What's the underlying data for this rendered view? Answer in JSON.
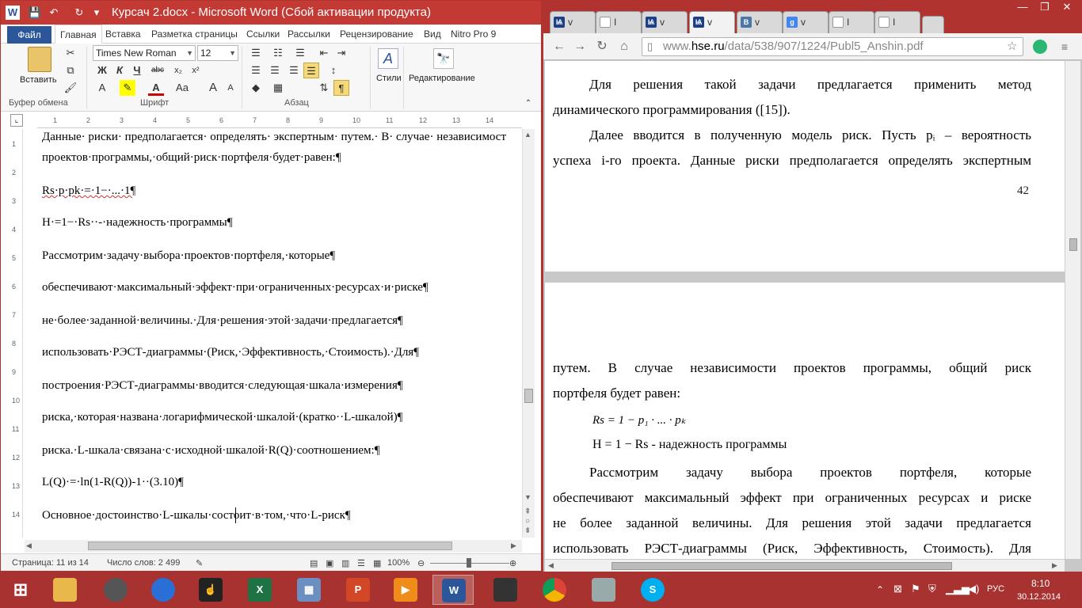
{
  "word": {
    "title": "Курсач 2.docx - Microsoft Word (Сбой активации продукта)",
    "qat": [
      "W",
      "💾",
      "↶",
      "↻",
      "▾"
    ],
    "window_controls": [
      "?",
      "⊡",
      "—",
      "▭",
      "✕"
    ],
    "tabs": [
      "Файл",
      "Главная",
      "Вставка",
      "Разметка страницы",
      "Ссылки",
      "Рассылки",
      "Рецензирование",
      "Вид",
      "Nitro Pro 9"
    ],
    "active_tab": "Главная",
    "ribbon": {
      "paste_label": "Вставить",
      "clipboard_label": "Буфер обмена",
      "font_label": "Шрифт",
      "paragraph_label": "Абзац",
      "styles_label": "Стили",
      "editing_label": "Редактирование",
      "font_name": "Times New Roman",
      "font_size": "12",
      "font_buttons": [
        "Ж",
        "К",
        "Ч",
        "abc",
        "x₂",
        "x²",
        "A",
        "Aa",
        "A",
        "A"
      ],
      "para_buttons": [
        "☰",
        "☰",
        "☰",
        "☰",
        "¶"
      ]
    },
    "ruler_numbers": [
      "1",
      "2",
      "3",
      "4",
      "5",
      "6",
      "7",
      "8",
      "9",
      "10",
      "11",
      "12",
      "13",
      "14"
    ],
    "doc_lines": [
      "Данные· риски· предполагается· определять· экспертным· путем.· В· случае· независимост",
      "проектов·программы,·общий·риск·портфеля·будет·равен:¶",
      "Rs·p·pk·=·1−·...·1¶",
      "H·=1−·Rs··-·надежность·программы¶",
      "Рассмотрим·задачу·выбора·проектов·портфеля,·которые¶",
      "обеспечивают·максимальный·эффект·при·ограниченных·ресурсах·и·риске¶",
      "не·более·заданной·величины.·Для·решения·этой·задачи·предлагается¶",
      "использовать·РЭСТ-диаграммы·(Риск,·Эффективность,·Стоимость).·Для¶",
      "построения·РЭСТ-диаграммы·вводится·следующая·шкала·измерения¶",
      "риска,·которая·названа·логарифмической·шкалой·(кратко··L-шкалой)¶",
      "риска.·L-шкала·связана·с·исходной·шкалой·R(Q)·соотношением:¶",
      "L(Q)·=·ln(1-R(Q))-1··(3.10)¶",
      "Основное·достоинство·L-шкалы·состоит·в·том,·что·L-риск¶"
    ],
    "status": {
      "page": "Страница: 11 из 14",
      "words": "Число слов: 2 499",
      "zoom": "100%"
    }
  },
  "browser": {
    "tabs": [
      {
        "label": "v",
        "favicon": "hse"
      },
      {
        "label": "I",
        "favicon": "doc"
      },
      {
        "label": "v",
        "favicon": "hse"
      },
      {
        "label": "v",
        "favicon": "hse"
      },
      {
        "label": "v",
        "favicon": "vk"
      },
      {
        "label": "v",
        "favicon": "google"
      },
      {
        "label": "I",
        "favicon": "doc"
      },
      {
        "label": "I",
        "favicon": "doc"
      }
    ],
    "active_tab_index": 3,
    "url_scheme": "www.",
    "url_host": "hse.ru",
    "url_path": "/data/538/907/1224/Publ5_Anshin.pdf",
    "pdf": {
      "page1_lines": [
        "Для решения такой задачи предлагается применить метод",
        "динамического программирования ([15]).",
        "Далее вводится в полученную модель риск. Пусть pᵢ – вероятность",
        "успеха i-го проекта. Данные риски предполагается определять экспертным"
      ],
      "page_number": "42",
      "page2_lines": [
        "путем. В случае независимости проектов программы, общий риск",
        "портфеля будет равен:",
        "Rs = 1 − p₁ · ... · pₖ",
        "H = 1 − Rs  - надежность программы",
        "Рассмотрим задачу выбора проектов портфеля, которые",
        "обеспечивают максимальный эффект при ограниченных ресурсах и риске",
        "не более заданной величины. Для решения этой задачи предлагается",
        "использовать РЭСТ-диаграммы (Риск, Эффективность, Стоимость). Для"
      ]
    }
  },
  "taskbar": {
    "apps": [
      "windows-start",
      "file-explorer",
      "app-swirl",
      "app-flower",
      "app-hand",
      "excel",
      "calculator",
      "powerpoint",
      "media-player",
      "word",
      "app-terminal",
      "chrome",
      "app-robot",
      "skype"
    ],
    "tray": {
      "lang": "РУС",
      "time": "8:10",
      "date": "30.12.2014"
    }
  },
  "colors": {
    "accent_red": "#c33a34",
    "word_blue": "#2b579a",
    "taskbar": "#a83230"
  }
}
